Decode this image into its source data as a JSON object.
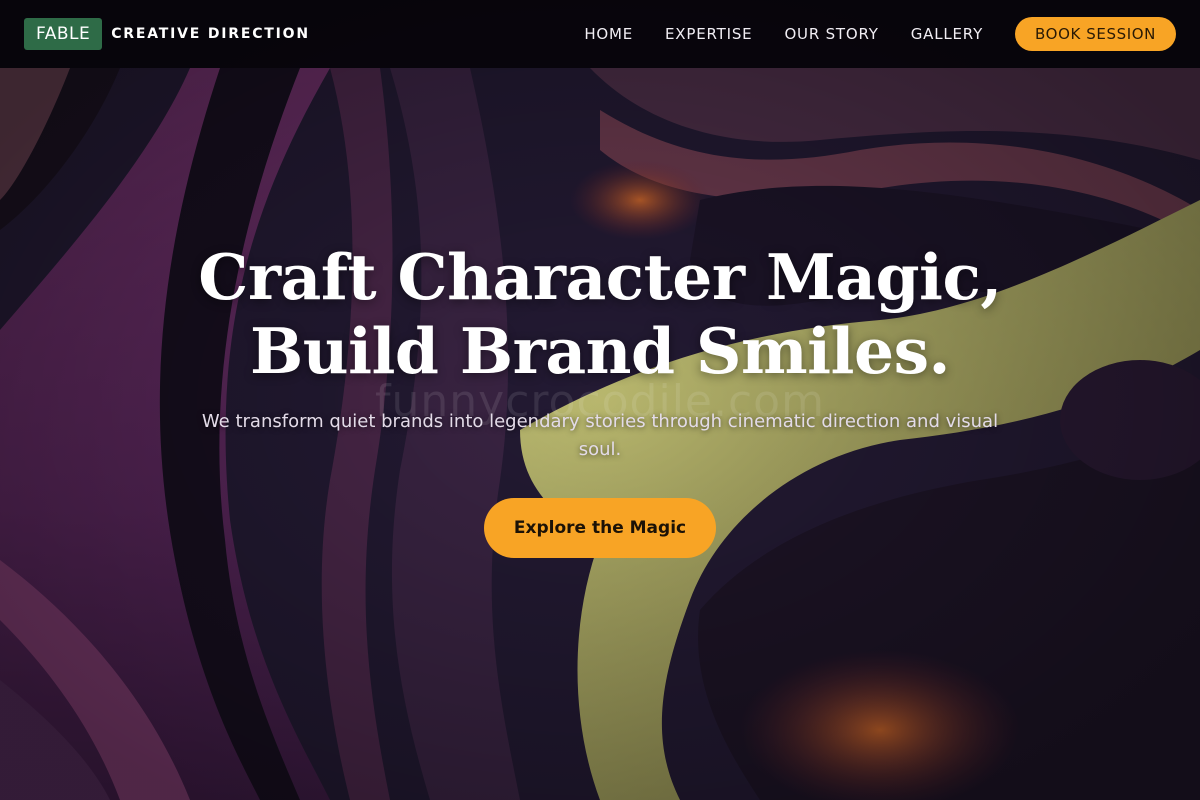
{
  "nav": {
    "brand_badge": "FABLE",
    "brand_tagline": "CREATIVE DIRECTION",
    "links": [
      "HOME",
      "EXPERTISE",
      "OUR STORY",
      "GALLERY"
    ],
    "book_label": "BOOK SESSION"
  },
  "hero": {
    "title_line1": "Craft Character Magic,",
    "title_line2": "Build Brand Smiles.",
    "subtitle": "We transform quiet brands into legendary stories through cinematic direction and visual soul.",
    "cta_label": "Explore the Magic",
    "watermark": "funnycrocodile.com"
  },
  "colors": {
    "accent": "#f8a425",
    "brand_badge": "#2e6b47",
    "nav_background": "#06040a",
    "hero_purple": "#5a2a5e",
    "hero_yellow": "#9c9a55"
  }
}
